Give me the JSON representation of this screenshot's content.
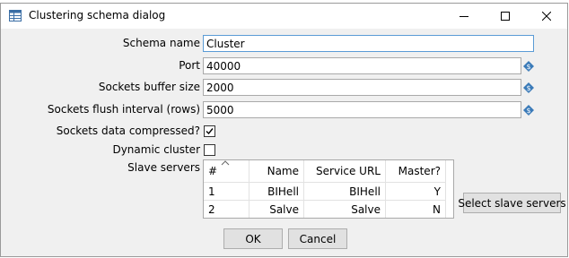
{
  "window": {
    "title": "Clustering schema dialog"
  },
  "form": {
    "schema_name": {
      "label": "Schema name",
      "value": "Cluster"
    },
    "port": {
      "label": "Port",
      "value": "40000"
    },
    "buffer_size": {
      "label": "Sockets buffer size",
      "value": "2000"
    },
    "flush_interval": {
      "label": "Sockets flush interval (rows)",
      "value": "5000"
    },
    "compressed": {
      "label": "Sockets data compressed?",
      "checked": true
    },
    "dynamic": {
      "label": "Dynamic cluster",
      "checked": false
    },
    "slave_servers_label": "Slave servers"
  },
  "slave_table": {
    "columns": [
      "#",
      "Name",
      "Service URL",
      "Master?"
    ],
    "rows": [
      [
        "1",
        "BIHell",
        "BIHell",
        "Y"
      ],
      [
        "2",
        "Salve",
        "Salve",
        "N"
      ]
    ]
  },
  "buttons": {
    "select_slave": "Select slave servers",
    "ok": "OK",
    "cancel": "Cancel"
  },
  "colors": {
    "focus_border": "#5a9bd5",
    "variable_icon": "#3a7ab8",
    "button_face": "#e1e1e1"
  }
}
